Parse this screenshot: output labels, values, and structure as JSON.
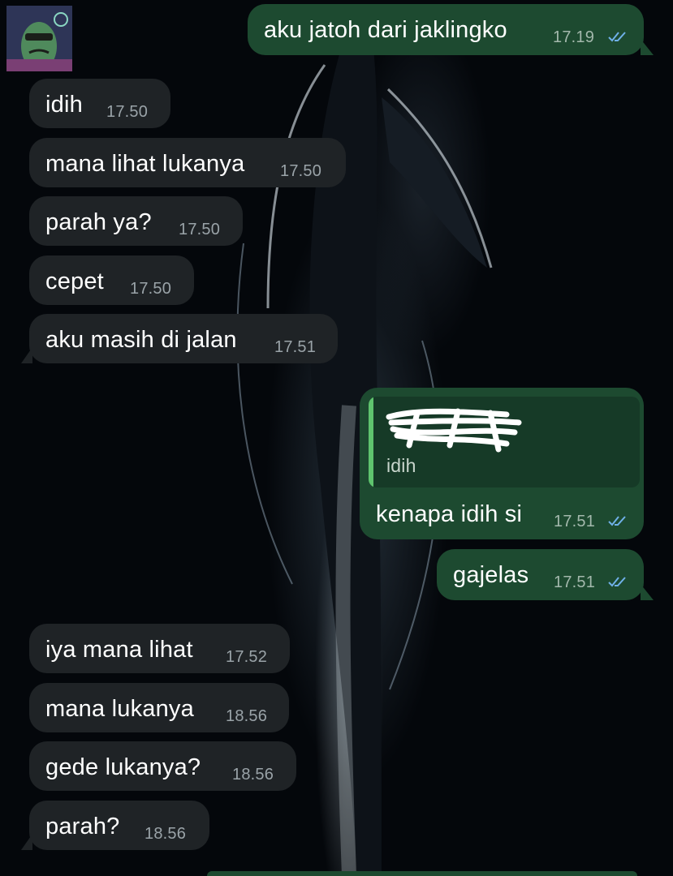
{
  "wallpaper": {
    "icon": "whale-ocean-wallpaper"
  },
  "contact": {
    "avatar_icon": "cartoon-character-avatar"
  },
  "colors": {
    "incoming_bubble": "#1f2326",
    "outgoing_bubble": "#1d4a30",
    "read_tick": "#6fb0e8",
    "quote_bar": "#5fc46e"
  },
  "messages": [
    {
      "dir": "out",
      "text": "aku jatoh dari jaklingko",
      "time": "17.19",
      "status": "read"
    },
    {
      "dir": "in",
      "text": "idih",
      "time": "17.50"
    },
    {
      "dir": "in",
      "text": "mana lihat lukanya",
      "time": "17.50"
    },
    {
      "dir": "in",
      "text": "parah ya?",
      "time": "17.50"
    },
    {
      "dir": "in",
      "text": "cepet",
      "time": "17.50"
    },
    {
      "dir": "in",
      "text": "aku masih di jalan",
      "time": "17.51"
    },
    {
      "dir": "out",
      "text": "kenapa idih si",
      "time": "17.51",
      "status": "read",
      "quote": {
        "sender_redacted": true,
        "text": "idih"
      }
    },
    {
      "dir": "out",
      "text": "gajelas",
      "time": "17.51",
      "status": "read"
    },
    {
      "dir": "in",
      "text": "iya mana lihat",
      "time": "17.52"
    },
    {
      "dir": "in",
      "text": "mana lukanya",
      "time": "18.56"
    },
    {
      "dir": "in",
      "text": "gede lukanya?",
      "time": "18.56"
    },
    {
      "dir": "in",
      "text": "parah?",
      "time": "18.56"
    }
  ]
}
